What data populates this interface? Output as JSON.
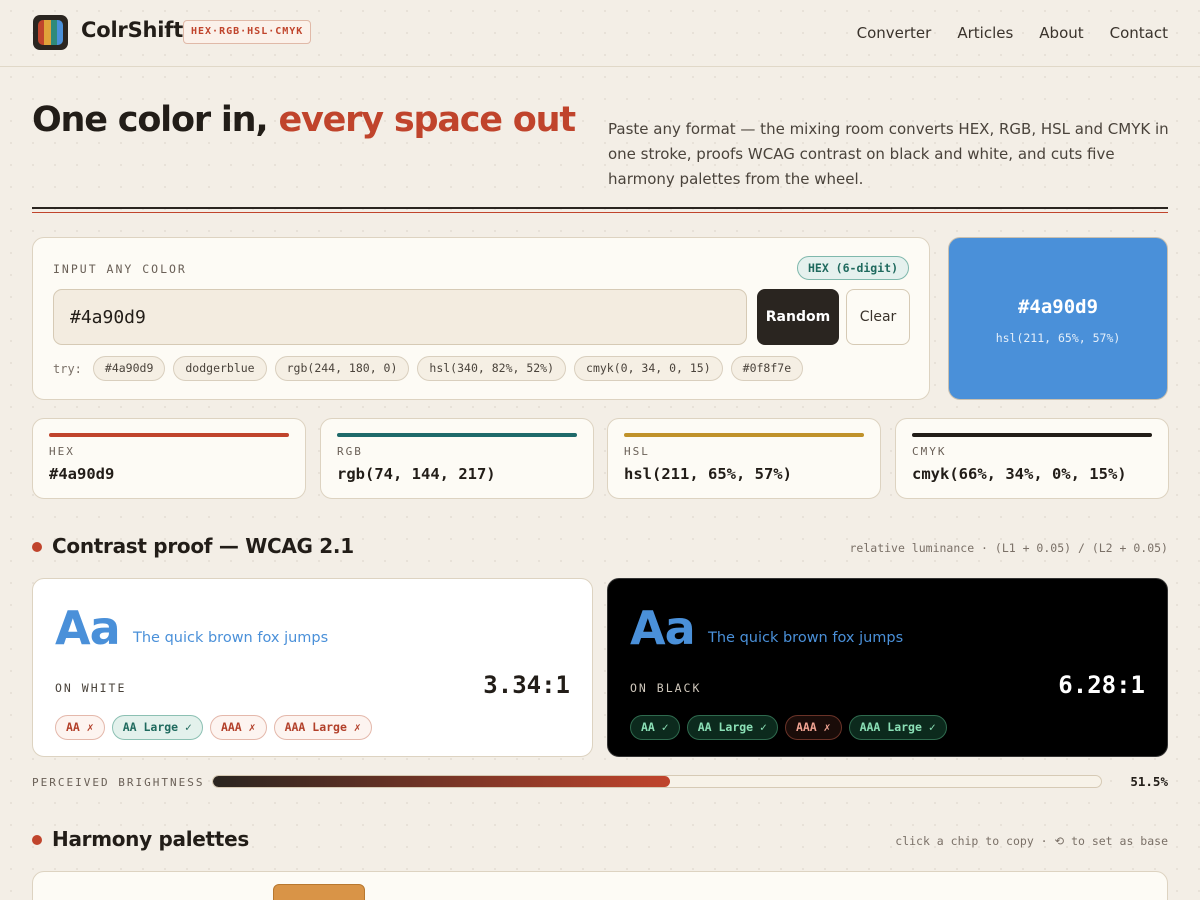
{
  "header": {
    "brand": "ColrShift",
    "tag": "HEX·RGB·HSL·CMYK",
    "logo_colors": [
      "#c0442c",
      "#e0a23a",
      "#2f8a7a",
      "#4a90d9"
    ],
    "nav": [
      "Converter",
      "Articles",
      "About",
      "Contact"
    ]
  },
  "hero": {
    "title_lead": "One color in, ",
    "title_accent": "every space out",
    "description": "Paste any format — the mixing room converts HEX, RGB, HSL and CMYK in one stroke, proofs WCAG contrast on black and white, and cuts five harmony palettes from the wheel."
  },
  "input": {
    "label": "INPUT ANY COLOR",
    "format_badge": "HEX (6-digit)",
    "value": "#4a90d9",
    "random_label": "Random",
    "clear_label": "Clear",
    "try_label": "try:",
    "examples": [
      "#4a90d9",
      "dodgerblue",
      "rgb(244, 180, 0)",
      "hsl(340, 82%, 52%)",
      "cmyk(0, 34, 0, 15)",
      "#0f8f7e"
    ]
  },
  "swatch": {
    "color": "#4a90d9",
    "hex": "#4a90d9",
    "hsl": "hsl(211, 65%, 57%)"
  },
  "values": {
    "hex": {
      "label": "HEX",
      "value": "#4a90d9",
      "accent": "#c0442c"
    },
    "rgb": {
      "label": "RGB",
      "value": "rgb(74, 144, 217)",
      "accent": "#1f6a6a"
    },
    "hsl": {
      "label": "HSL",
      "value": "hsl(211, 65%, 57%)",
      "accent": "#c0922a"
    },
    "cmyk": {
      "label": "CMYK",
      "value": "cmyk(66%, 34%, 0%, 15%)",
      "accent": "#221d18"
    }
  },
  "contrast": {
    "title": "Contrast proof — WCAG 2.1",
    "formula": "relative luminance · (L1 + 0.05) / (L2 + 0.05)",
    "sample_glyph": "Aa",
    "sample_text": "The quick brown fox jumps",
    "white": {
      "on_label": "ON WHITE",
      "ratio": "3.34:1",
      "badges": [
        {
          "label": "AA ✗",
          "pass": false
        },
        {
          "label": "AA Large ✓",
          "pass": true
        },
        {
          "label": "AAA ✗",
          "pass": false
        },
        {
          "label": "AAA Large ✗",
          "pass": false
        }
      ]
    },
    "black": {
      "on_label": "ON BLACK",
      "ratio": "6.28:1",
      "badges": [
        {
          "label": "AA ✓",
          "pass": true
        },
        {
          "label": "AA Large ✓",
          "pass": true
        },
        {
          "label": "AAA ✗",
          "pass": false
        },
        {
          "label": "AAA Large ✓",
          "pass": true
        }
      ]
    }
  },
  "brightness": {
    "label": "PERCEIVED BRIGHTNESS",
    "value_text": "51.5%",
    "fraction": 0.515
  },
  "harmony": {
    "title": "Harmony palettes",
    "note": "click a chip to copy · ⟲ to set as base",
    "first_chip_color": "#d99447"
  }
}
